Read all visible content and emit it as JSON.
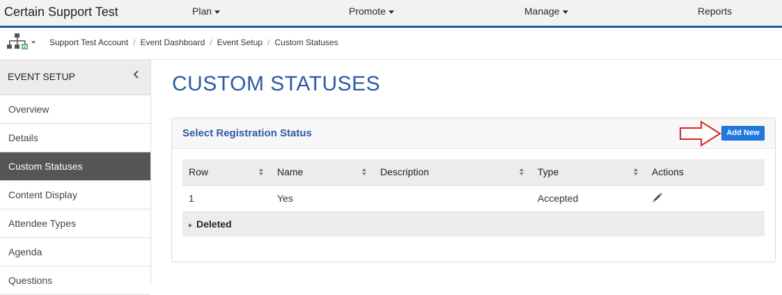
{
  "app": {
    "title": "Certain Support Test",
    "nav": [
      {
        "label": "Plan",
        "dropdown": true
      },
      {
        "label": "Promote",
        "dropdown": true
      },
      {
        "label": "Manage",
        "dropdown": true
      },
      {
        "label": "Reports",
        "dropdown": false
      }
    ],
    "accent_color": "#2457a4"
  },
  "breadcrumb": {
    "icon": "sitemap-icon",
    "items": [
      "Support Test Account",
      "Event Dashboard",
      "Event Setup",
      "Custom Statuses"
    ]
  },
  "sidebar": {
    "title": "EVENT SETUP",
    "collapse_icon": "chevron-left-icon",
    "items": [
      {
        "label": "Overview",
        "active": false
      },
      {
        "label": "Details",
        "active": false
      },
      {
        "label": "Custom Statuses",
        "active": true
      },
      {
        "label": "Content Display",
        "active": false
      },
      {
        "label": "Attendee Types",
        "active": false
      },
      {
        "label": "Agenda",
        "active": false
      },
      {
        "label": "Questions",
        "active": false
      }
    ]
  },
  "main": {
    "page_title": "CUSTOM STATUSES",
    "panel": {
      "title": "Select Registration Status",
      "add_button": "Add New",
      "annotation_icon": "red-arrow-icon",
      "columns": [
        "Row",
        "Name",
        "Description",
        "Type",
        "Actions"
      ],
      "rows": [
        {
          "row": "1",
          "name": "Yes",
          "description": "",
          "type": "Accepted",
          "action_icon": "pencil-icon"
        }
      ],
      "deleted_label": "Deleted"
    }
  }
}
